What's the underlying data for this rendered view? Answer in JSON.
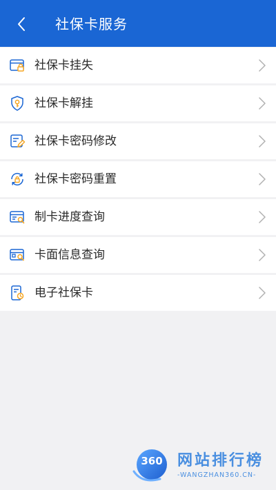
{
  "header": {
    "title": "社保卡服务",
    "back_icon": "chevron-left-icon",
    "background": "#1a66d4"
  },
  "menu": {
    "items": [
      {
        "label": "社保卡挂失",
        "icon": "card-lock-icon"
      },
      {
        "label": "社保卡解挂",
        "icon": "shield-key-icon"
      },
      {
        "label": "社保卡密码修改",
        "icon": "document-edit-icon"
      },
      {
        "label": "社保卡密码重置",
        "icon": "refresh-lock-icon"
      },
      {
        "label": "制卡进度查询",
        "icon": "card-search-icon"
      },
      {
        "label": "卡面信息查询",
        "icon": "card-info-search-icon"
      },
      {
        "label": "电子社保卡",
        "icon": "mobile-card-icon"
      }
    ],
    "chevron_icon": "chevron-right-icon"
  },
  "watermark": {
    "badge": "360",
    "name": "网站排行榜",
    "url": "-WANGZHAN360.CN-",
    "color": "#4a8fe0"
  },
  "colors": {
    "accent": "#1a66d4",
    "icon_orange": "#f5a623",
    "page_background": "#f1f1f3"
  }
}
